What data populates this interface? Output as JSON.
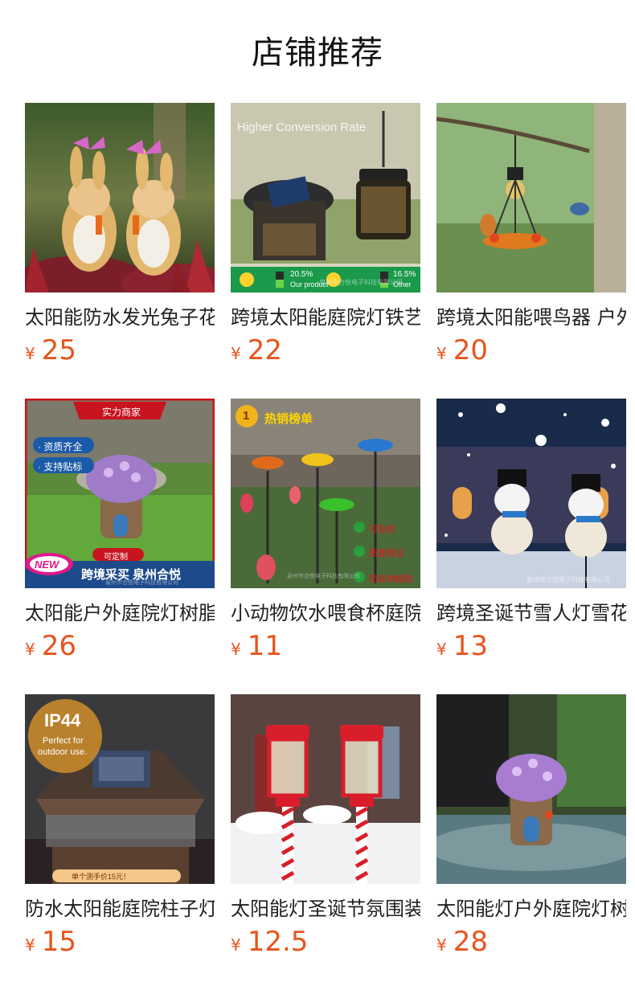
{
  "page": {
    "title": "店铺推荐"
  },
  "currency_symbol": "¥",
  "products": [
    {
      "title": "太阳能防水发光兔子花园装饰灯",
      "price": "25",
      "image": "rabbit-statues-image"
    },
    {
      "title": "跨境太阳能庭院灯铁艺手提灯",
      "price": "22",
      "image": "solar-lantern-image",
      "overlays": {
        "headline": "Higher Conversion Rate",
        "stat_left": "20.5%",
        "stat_left_caption": "Our product",
        "stat_right": "16.5%",
        "stat_right_caption": "Other",
        "watermark": "泉州市合悦电子科技有限公司"
      }
    },
    {
      "title": "跨境太阳能喂鸟器 户外悬挂",
      "price": "20",
      "image": "bird-feeder-image"
    },
    {
      "title": "太阳能户外庭院灯树脂蘑菇屋",
      "price": "26",
      "image": "mushroom-house-image",
      "overlays": {
        "banner": "实力商家",
        "tag_1": "· 资质齐全",
        "tag_2": "· 支持贴标",
        "new_badge": "NEW",
        "custom_tag": "可定制",
        "bottom_banner": "跨境采买 泉州合悦",
        "watermark": "泉州市合悦电子科技有限公司"
      }
    },
    {
      "title": "小动物饮水喂食杯庭院插地灯",
      "price": "11",
      "image": "feeding-cups-image",
      "overlays": {
        "rank_number": "1",
        "rank_label": "热销榜单",
        "check_1": "可贴标",
        "check_2": "质量保证",
        "check_3": "简易地插款",
        "watermark": "泉州市合悦电子科技有限公司"
      }
    },
    {
      "title": "跨境圣诞节雪人灯雪花投影灯",
      "price": "13",
      "image": "snowman-lights-image",
      "overlays": {
        "watermark": "泉州市合悦电子科技有限公司"
      }
    },
    {
      "title": "防水太阳能庭院柱子灯柱头灯",
      "price": "15",
      "image": "post-cap-light-image",
      "overlays": {
        "badge_title": "IP44",
        "badge_line_1": "Perfect for",
        "badge_line_2": "outdoor use.",
        "bottom_note": "单个测手价15元！"
      }
    },
    {
      "title": "太阳能灯圣诞节氛围装饰地插灯",
      "price": "12.5",
      "image": "christmas-stake-lights-image"
    },
    {
      "title": "太阳能灯户外庭院灯树脂小屋",
      "price": "28",
      "image": "fairy-house-image"
    }
  ],
  "colors": {
    "price": "#e8541c",
    "title_text": "#222222",
    "background": "#ffffff"
  }
}
